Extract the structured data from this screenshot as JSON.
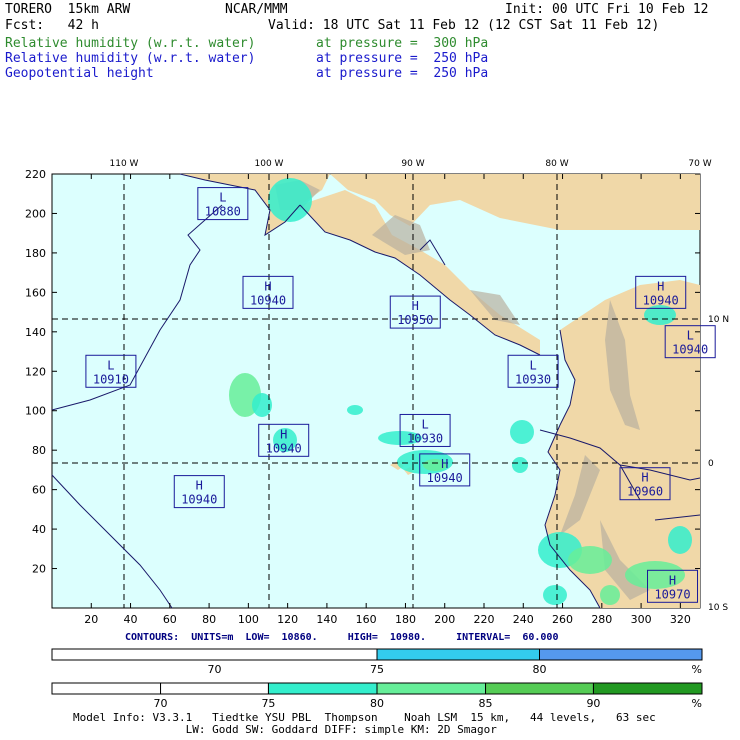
{
  "header": {
    "model": "TORERO  15km ARW",
    "center": "NCAR/MMM",
    "init": "Init: 00 UTC Fri 10 Feb 12",
    "fcst": "Fcst:   42 h",
    "valid": "Valid: 18 UTC Sat 11 Feb 12 (12 CST Sat 11 Feb 12)",
    "fields": [
      {
        "name": "Relative humidity (w.r.t. water)",
        "level": "at pressure =  300 hPa",
        "color": "#2e8b2e"
      },
      {
        "name": "Relative humidity (w.r.t. water)",
        "level": "at pressure =  250 hPa",
        "color": "#1a1acc"
      },
      {
        "name": "Geopotential height",
        "level": "at pressure =  250 hPa",
        "color": "#1a1acc"
      }
    ]
  },
  "map": {
    "top_lon_labels": [
      "110 W",
      "100 W",
      "90 W",
      "80 W",
      "70 W"
    ],
    "right_lat_labels": [
      "10 N",
      "0",
      "10 S"
    ],
    "x_ticks": [
      "20",
      "40",
      "60",
      "80",
      "100",
      "120",
      "140",
      "160",
      "180",
      "200",
      "220",
      "240",
      "260",
      "280",
      "300",
      "320"
    ],
    "y_ticks": [
      "20",
      "40",
      "60",
      "80",
      "100",
      "120",
      "140",
      "160",
      "180",
      "200",
      "220"
    ],
    "ocean_color": "#dcfffe",
    "land_color": "#f0d8a8",
    "box_color": "#1a1a9a",
    "centers": [
      {
        "type": "L",
        "value": "10880",
        "x": 87,
        "y": 205
      },
      {
        "type": "H",
        "value": "10940",
        "x": 110,
        "y": 160
      },
      {
        "type": "H",
        "value": "10950",
        "x": 185,
        "y": 150
      },
      {
        "type": "L",
        "value": "10910",
        "x": 30,
        "y": 120
      },
      {
        "type": "L",
        "value": "10930",
        "x": 245,
        "y": 120
      },
      {
        "type": "H",
        "value": "10940",
        "x": 310,
        "y": 160
      },
      {
        "type": "L",
        "value": "10940",
        "x": 325,
        "y": 135
      },
      {
        "type": "H",
        "value": "10940",
        "x": 118,
        "y": 85
      },
      {
        "type": "L",
        "value": "10930",
        "x": 190,
        "y": 90
      },
      {
        "type": "H",
        "value": "10940",
        "x": 200,
        "y": 70
      },
      {
        "type": "H",
        "value": "10940",
        "x": 75,
        "y": 59
      },
      {
        "type": "H",
        "value": "10960",
        "x": 302,
        "y": 63
      },
      {
        "type": "H",
        "value": "10970",
        "x": 316,
        "y": 11
      }
    ]
  },
  "contours": {
    "label": "CONTOURS:  UNITS=m  LOW=  10860.     HIGH=  10980.     INTERVAL=  60.000"
  },
  "colorbars": [
    {
      "name": "rh-300",
      "segments": [
        {
          "color": "#ffffff",
          "from": 0,
          "to": 0.5
        },
        {
          "color": "#33ccee",
          "from": 0.5,
          "to": 0.75
        },
        {
          "color": "#5599ee",
          "from": 0.75,
          "to": 1
        }
      ],
      "labels": [
        {
          "text": "70",
          "pos": 0.25
        },
        {
          "text": "75",
          "pos": 0.5
        },
        {
          "text": "80",
          "pos": 0.75
        },
        {
          "text": "%",
          "pos": 1
        }
      ]
    },
    {
      "name": "rh-250",
      "segments": [
        {
          "color": "#ffffff",
          "from": 0,
          "to": 0.167
        },
        {
          "color": "#ffffff",
          "from": 0.167,
          "to": 0.333
        },
        {
          "color": "#33eecc",
          "from": 0.333,
          "to": 0.5
        },
        {
          "color": "#66ee99",
          "from": 0.5,
          "to": 0.667
        },
        {
          "color": "#55cc55",
          "from": 0.667,
          "to": 0.833
        },
        {
          "color": "#229922",
          "from": 0.833,
          "to": 1
        }
      ],
      "labels": [
        {
          "text": "70",
          "pos": 0.167
        },
        {
          "text": "75",
          "pos": 0.333
        },
        {
          "text": "80",
          "pos": 0.5
        },
        {
          "text": "85",
          "pos": 0.667
        },
        {
          "text": "90",
          "pos": 0.833
        },
        {
          "text": "%",
          "pos": 1
        }
      ]
    }
  ],
  "footer": {
    "line1": "Model Info: V3.3.1   Tiedtke YSU PBL  Thompson    Noah LSM  15 km,   44 levels,   63 sec",
    "line2": "                 LW: Godd SW: Goddard DIFF: simple KM: 2D Smagor"
  }
}
